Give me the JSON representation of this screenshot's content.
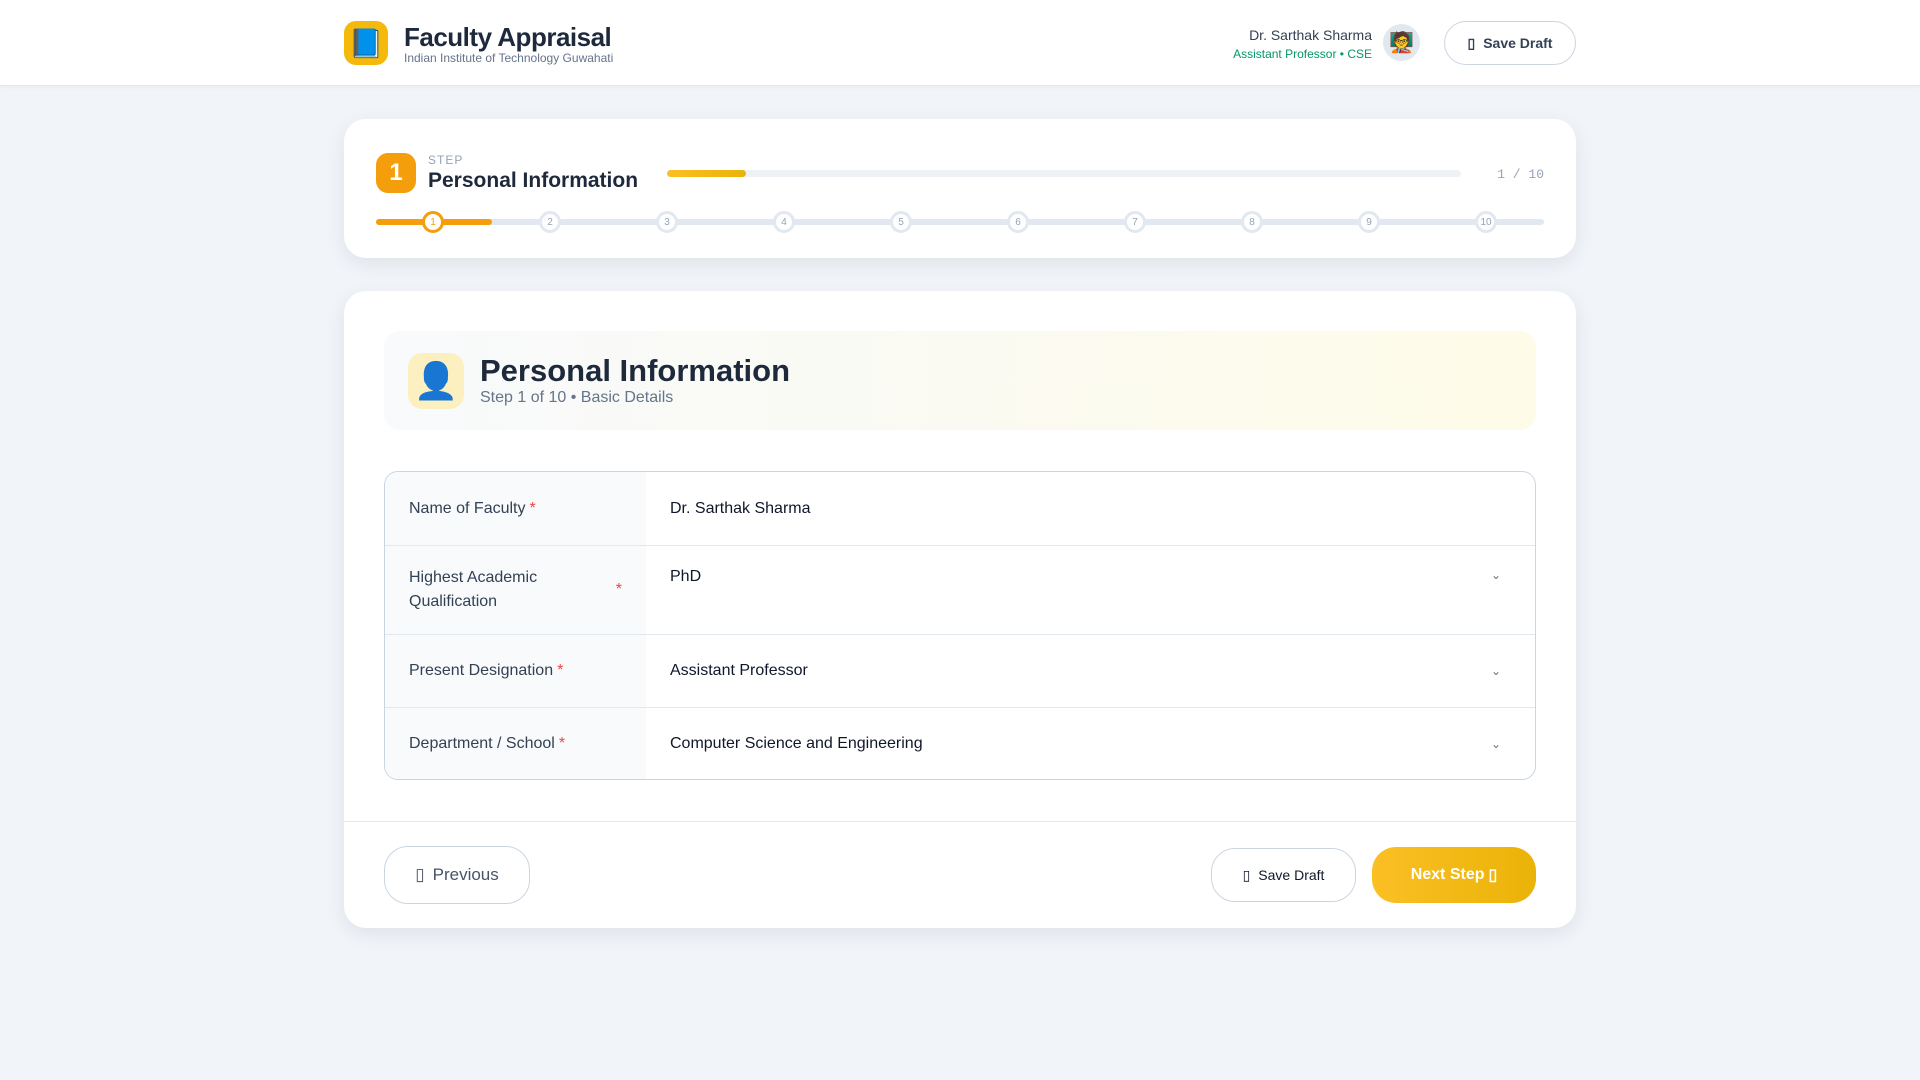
{
  "header": {
    "title": "Faculty Appraisal",
    "subtitle": "Indian Institute of Technology Guwahati",
    "logo_icon": "📘",
    "user_name": "Dr. Sarthak Sharma",
    "user_role": "Assistant Professor • CSE",
    "avatar_icon": "🧑‍🏫",
    "save_draft": "Save Draft",
    "save_icon": "▯"
  },
  "stepper": {
    "label": "STEP",
    "number": "1",
    "title": "Personal Information",
    "count": "1 / 10",
    "progress_percent": 10,
    "steps": [
      "1",
      "2",
      "3",
      "4",
      "5",
      "6",
      "7",
      "8",
      "9",
      "10"
    ],
    "current": 1
  },
  "section": {
    "icon": "👤",
    "title": "Personal Information",
    "subtitle": "Step 1 of 10 • Basic Details"
  },
  "form": {
    "fields": [
      {
        "label": "Name of Faculty",
        "value": "Dr. Sarthak Sharma",
        "type": "text"
      },
      {
        "label": "Highest Academic Qualification",
        "value": "PhD",
        "type": "select"
      },
      {
        "label": "Present Designation",
        "value": "Assistant Professor",
        "type": "select"
      },
      {
        "label": "Department / School",
        "value": "Computer Science and Engineering",
        "type": "select"
      }
    ],
    "required_mark": "*",
    "chevron": "⌄"
  },
  "footer": {
    "previous": "Previous",
    "previous_icon": "▯",
    "save_draft": "Save Draft",
    "save_icon": "▯",
    "next": "Next Step",
    "next_icon": "▯"
  },
  "colors": {
    "accent": "#f59e0b",
    "gold": "#eab308",
    "green": "#059669",
    "required": "#ef4444"
  }
}
